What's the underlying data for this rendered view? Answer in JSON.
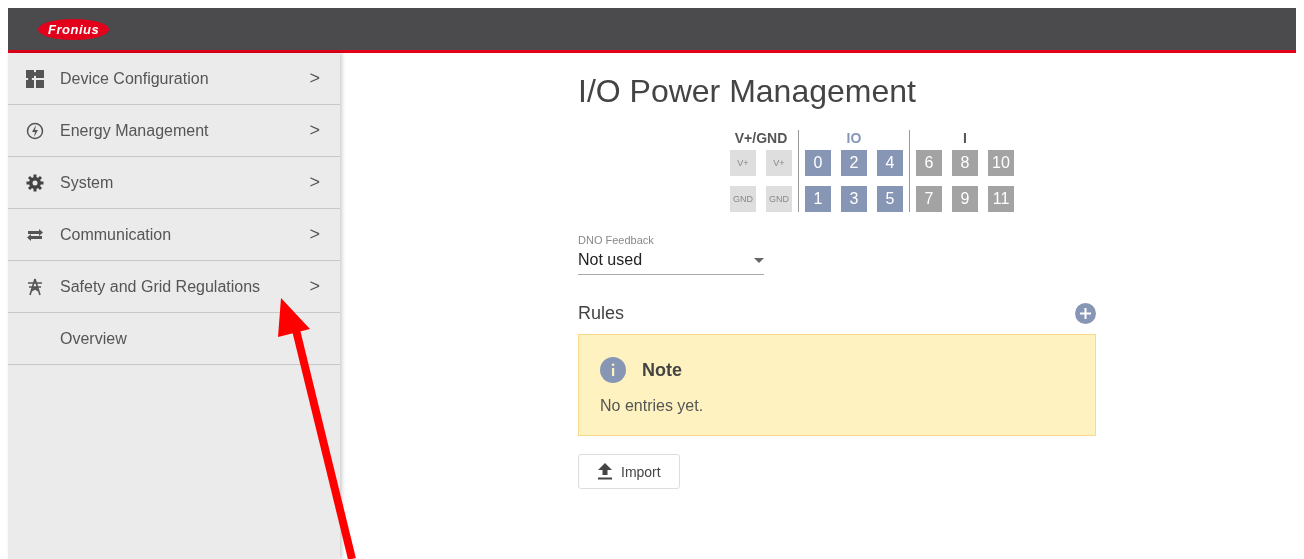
{
  "header": {
    "logo": "Fronius"
  },
  "sidebar": {
    "items": [
      {
        "label": "Device Configuration",
        "chevron": ">"
      },
      {
        "label": "Energy Management",
        "chevron": ">"
      },
      {
        "label": "System",
        "chevron": ">"
      },
      {
        "label": "Communication",
        "chevron": ">"
      },
      {
        "label": "Safety and Grid Regulations",
        "chevron": ">"
      },
      {
        "label": "Overview"
      }
    ]
  },
  "page": {
    "title": "I/O Power Management"
  },
  "pin_groups": [
    {
      "label": "V+/GND",
      "kind": "power",
      "columns": [
        [
          "V+",
          "GND"
        ],
        [
          "V+",
          "GND"
        ]
      ]
    },
    {
      "label": "IO",
      "kind": "io",
      "columns": [
        [
          "0",
          "1"
        ],
        [
          "2",
          "3"
        ],
        [
          "4",
          "5"
        ]
      ]
    },
    {
      "label": "I",
      "kind": "input",
      "columns": [
        [
          "6",
          "7"
        ],
        [
          "8",
          "9"
        ],
        [
          "10",
          "11"
        ]
      ]
    }
  ],
  "dno_feedback": {
    "label": "DNO Feedback",
    "value": "Not used"
  },
  "rules": {
    "title": "Rules",
    "note": {
      "title": "Note",
      "text": "No entries yet."
    }
  },
  "import_button": {
    "label": "Import"
  },
  "annotation": {
    "kind": "arrow"
  }
}
